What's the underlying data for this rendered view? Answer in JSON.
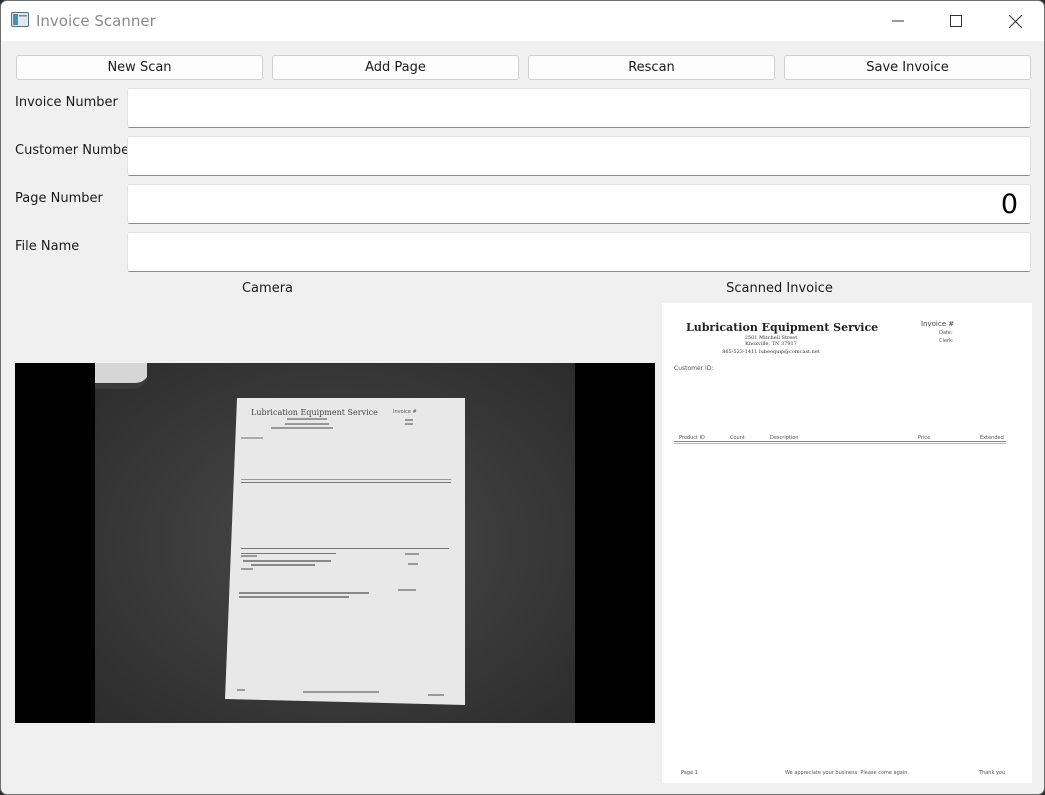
{
  "window": {
    "title": "Invoice Scanner",
    "icon": "app-window-icon"
  },
  "toolbar": {
    "new_scan": "New Scan",
    "add_page": "Add Page",
    "rescan": "Rescan",
    "save_invoice": "Save Invoice"
  },
  "form": {
    "invoice_number": {
      "label": "Invoice Number",
      "value": ""
    },
    "customer_number": {
      "label": "Customer Number",
      "value": ""
    },
    "page_number": {
      "label": "Page Number",
      "value": "0"
    },
    "file_name": {
      "label": "File Name",
      "value": ""
    }
  },
  "sections": {
    "camera": "Camera",
    "scanned": "Scanned Invoice"
  },
  "camera_doc": {
    "company": "Lubrication Equipment Service",
    "invoice_label": "Invoice #"
  },
  "scanned_doc": {
    "company": "Lubrication Equipment Service",
    "address1": "2501 Mitchell Street",
    "address2": "Knoxville, TN 37917",
    "contact": "865-523-1411 lubeequip@comcast.net",
    "invoice_label": "Invoice #",
    "date_label": "Date:",
    "clerk_label": "Clerk:",
    "customer_id": "Customer ID:",
    "columns": [
      "Product ID",
      "Count",
      "Description",
      "Price",
      "Extended"
    ],
    "footer_page": "Page 1",
    "footer_msg": "We appreciate your business. Please come again.",
    "footer_thanks": "Thank you"
  }
}
